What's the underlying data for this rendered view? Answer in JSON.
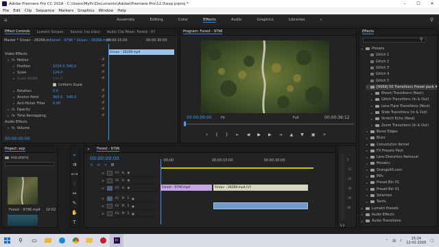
{
  "window": {
    "title": "Adobe Premiere Pro CC 2018 - C:\\Users\\MyPc\\Documents\\Adobe\\Premiere Pro\\12.0\\exp.prproj *"
  },
  "menu": [
    "File",
    "Edit",
    "Clip",
    "Sequence",
    "Markers",
    "Graphics",
    "Window",
    "Help"
  ],
  "workspaces": [
    "Assembly",
    "Editing",
    "Color",
    "Effects",
    "Audio",
    "Graphics",
    "Libraries"
  ],
  "workspace_active": "Effects",
  "effect_controls": {
    "tabs": [
      "Effect Controls",
      "Lumetri Scopes",
      "Source: (no clips)",
      "Audio Clip Mixer: Forest - 97"
    ],
    "master": "Master * Ocean - 28268.m...",
    "sequence": "Forest - 9796 * Ocean - 28268.mp4",
    "ruler_time": ":00:00",
    "ruler_time2": "00:00:15:00",
    "ruler_time3": "00:00:30:00",
    "clip_label": "Ocean - 28268.mp4",
    "video_effects": "Video Effects",
    "props": [
      {
        "name": "Motion",
        "v1": "",
        "v2": ""
      },
      {
        "name": "Position",
        "v1": "1024.0",
        "v2": "540.0"
      },
      {
        "name": "Scale",
        "v1": "124.0",
        "v2": ""
      },
      {
        "name": "Scale Width",
        "v1": "100.0",
        "v2": ""
      },
      {
        "name": "Uniform Scale",
        "v1": "",
        "v2": ""
      },
      {
        "name": "Rotation",
        "v1": "0.0",
        "v2": ""
      },
      {
        "name": "Anchor Point",
        "v1": "960.0",
        "v2": "540.0"
      },
      {
        "name": "Anti-flicker Filter",
        "v1": "0.00",
        "v2": ""
      },
      {
        "name": "Opacity",
        "v1": "",
        "v2": ""
      },
      {
        "name": "Time Remapping",
        "v1": "",
        "v2": ""
      }
    ],
    "audio_effects": "Audio Effects",
    "volume": "Volume",
    "timecode": "00:00:00:00"
  },
  "program": {
    "tab": "Program: Forest - 9796",
    "timecode": "00:00:00:00",
    "fit": "Fit",
    "quality": "Full",
    "duration": "00:00:36:12"
  },
  "project": {
    "tab": "Project: exp",
    "file": "exp.prproj",
    "thumbs": [
      {
        "name": "Forest - 9796.mp4",
        "dur": "10:02"
      },
      {
        "name": "",
        "dur": ""
      }
    ]
  },
  "timeline": {
    "tab": "Forest - 9796",
    "timecode": "00:00:00:00",
    "ruler": [
      ":00:00",
      "00:00:15:00",
      "00:00:30:00"
    ],
    "video_tracks": [
      "V3",
      "V2",
      "V1"
    ],
    "audio_tracks": [
      "A1",
      "A2",
      "A3"
    ],
    "clip_v1a": "Forest - 9796.mp4",
    "clip_v1b": "Ocean - 28268.mp4 [V]",
    "meter_labels": [
      "0",
      "-12",
      "-24",
      "-36",
      "-48",
      "dB"
    ],
    "meter_bottom": "S  S"
  },
  "effects": {
    "tab": "Effects",
    "items": [
      {
        "label": "Presets",
        "level": 0,
        "open": true
      },
      {
        "label": "Glitch 1",
        "level": 1
      },
      {
        "label": "Glitch 2",
        "level": 1
      },
      {
        "label": "Glitch 3",
        "level": 1
      },
      {
        "label": "Glitch 4",
        "level": 1
      },
      {
        "label": "Glitch 5",
        "level": 1
      },
      {
        "label": "[6669] 50 Transitions Preset pack 4",
        "level": 1,
        "open": true,
        "selected": true
      },
      {
        "label": "Bloom Transitions (Nest)",
        "level": 2
      },
      {
        "label": "Glitch Transitions (In & Out)",
        "level": 2
      },
      {
        "label": "Lens Flare Transitions (Nest)",
        "level": 2
      },
      {
        "label": "Slide Transitions (In & Out)",
        "level": 2
      },
      {
        "label": "Stretch Echo (Nest)",
        "level": 2
      },
      {
        "label": "Zoom Transitions (In & Out)",
        "level": 2
      },
      {
        "label": "Bevel Edges",
        "level": 1
      },
      {
        "label": "Blurs",
        "level": 1
      },
      {
        "label": "Convolution Kernel",
        "level": 1
      },
      {
        "label": "FX Presets Pack",
        "level": 1
      },
      {
        "label": "Lens Distortion Removal",
        "level": 1
      },
      {
        "label": "Mosaics",
        "level": 1
      },
      {
        "label": "Orange93.com",
        "level": 1
      },
      {
        "label": "PiPs",
        "level": 1
      },
      {
        "label": "Preset Bin 01",
        "level": 1
      },
      {
        "label": "Preset Bin 01",
        "level": 1
      },
      {
        "label": "Solarizes",
        "level": 1
      },
      {
        "label": "Twirls",
        "level": 1
      },
      {
        "label": "Lumetri Presets",
        "level": 0
      },
      {
        "label": "Audio Effects",
        "level": 0
      },
      {
        "label": "Audio Transitions",
        "level": 0
      }
    ]
  },
  "taskbar": {
    "time": "15:24",
    "date": "12-02-2020"
  },
  "colors": {
    "accent": "#2d8ceb",
    "clip_video": "#c8a7e6",
    "clip_audio": "#5a8fbf",
    "selected_track": "#3a5f9e"
  }
}
